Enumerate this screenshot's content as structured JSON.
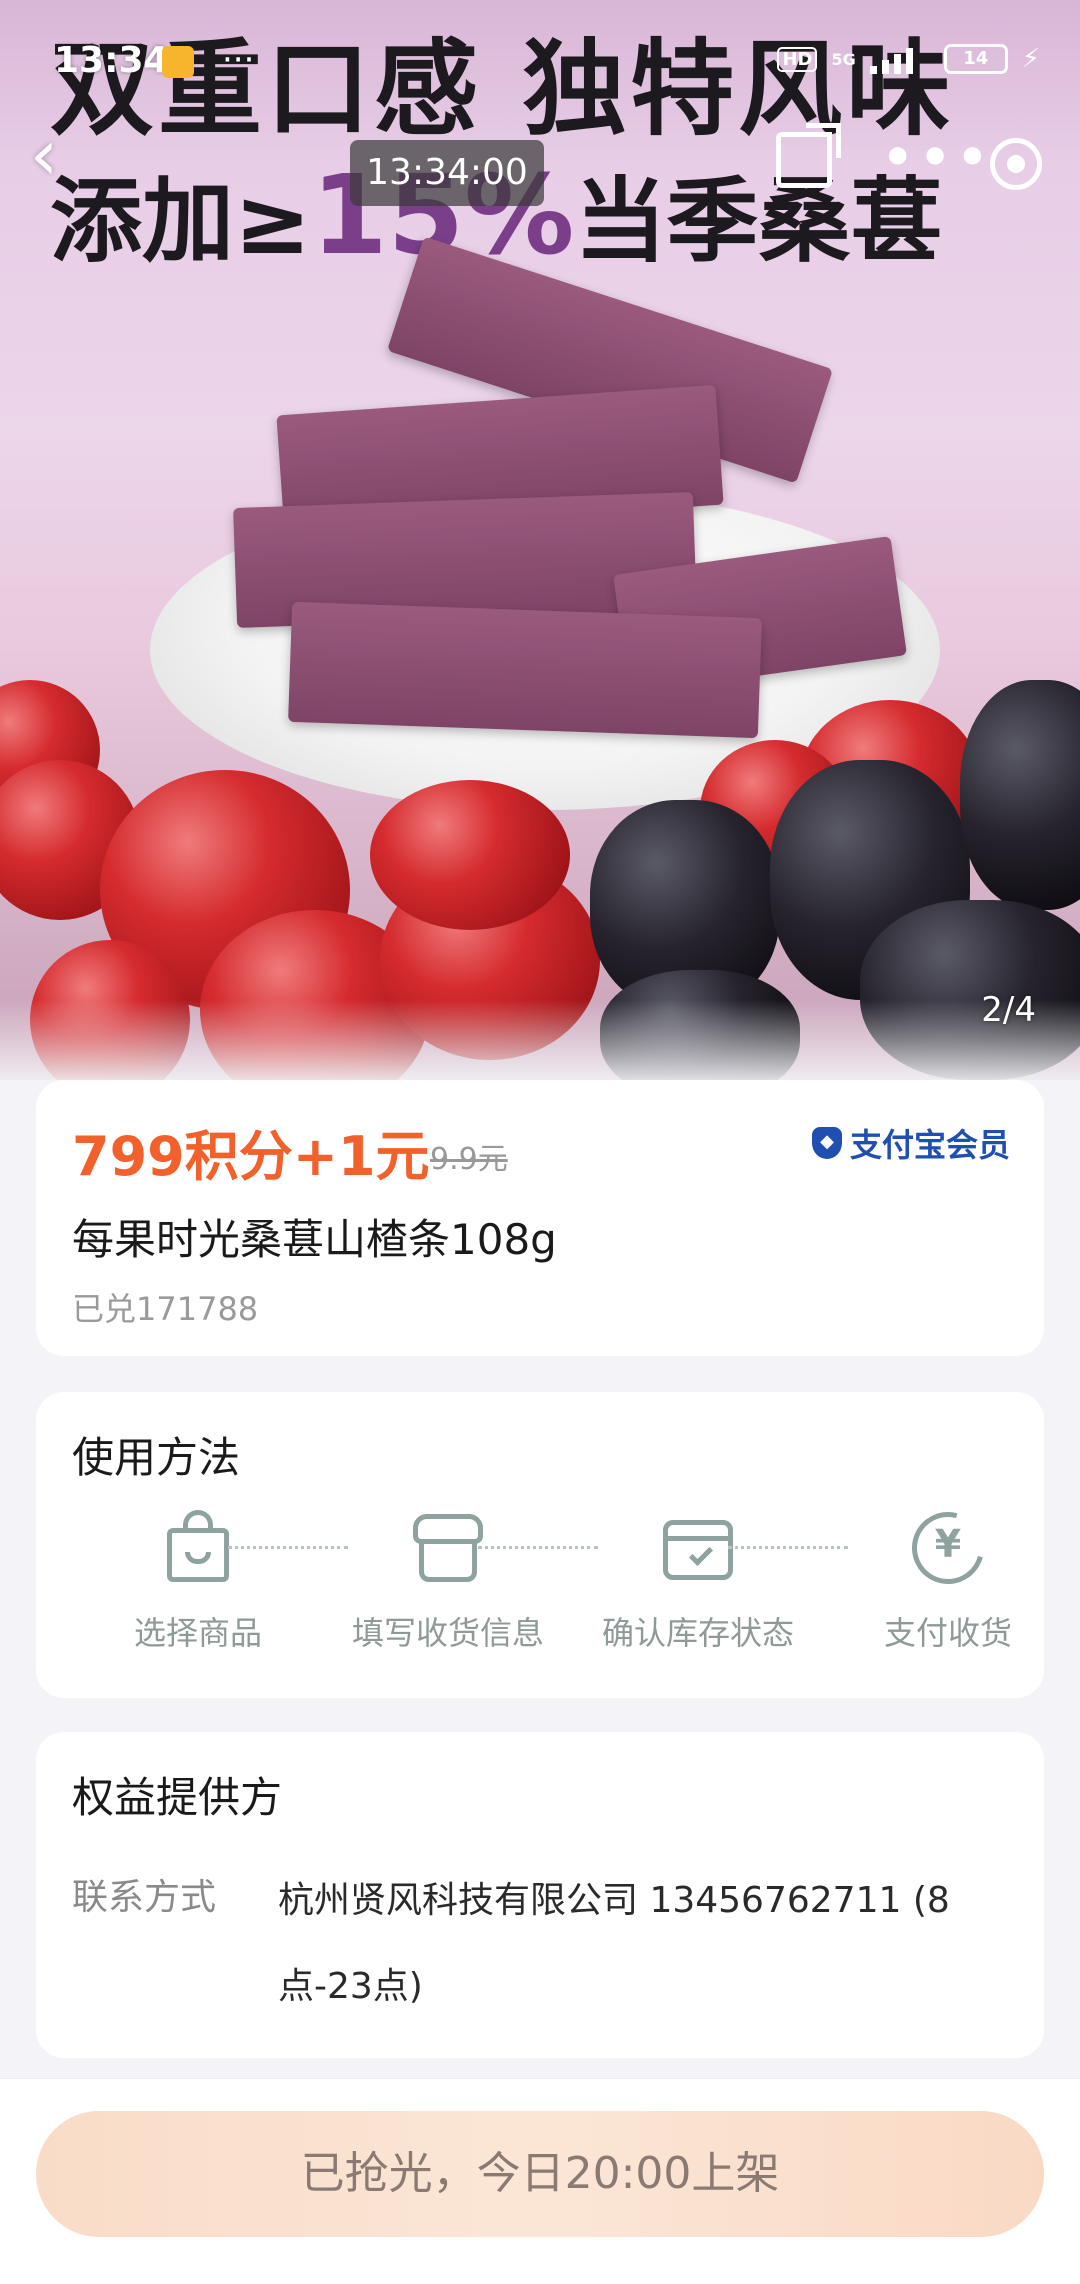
{
  "status_bar": {
    "time": "13:34",
    "dots": "···",
    "hd": "HD",
    "network": "5G",
    "battery": "14"
  },
  "nav": {
    "back_icon": "back-chevron-icon",
    "clock": "13:34:00",
    "share_icon": "share-icon",
    "more_icon": "more-icon",
    "target_icon": "target-icon"
  },
  "hero": {
    "headline_line1": "双重口感 独特风味",
    "headline_line2_a": "添加≥",
    "headline_line2_pct": "15%",
    "headline_line2_b": "当季桑葚",
    "page_indicator": "2/4"
  },
  "product": {
    "price": "799积分+1元",
    "original_price": "9.9元",
    "member_badge": "支付宝会员",
    "name": "每果时光桑葚山楂条108g",
    "sold": "已兑171788"
  },
  "usage": {
    "title": "使用方法",
    "steps": [
      {
        "label": "选择商品",
        "icon": "shopping-bag-icon"
      },
      {
        "label": "填写收货信息",
        "icon": "store-icon"
      },
      {
        "label": "确认库存状态",
        "icon": "package-check-icon"
      },
      {
        "label": "支付收货",
        "icon": "yuan-refresh-icon"
      }
    ]
  },
  "provider": {
    "title": "权益提供方",
    "contact_label": "联系方式",
    "contact_value": "杭州贤风科技有限公司 13456762711 (8点-23点)"
  },
  "bottom": {
    "button_label": "已抢光，今日20:00上架"
  },
  "colors": {
    "price": "#f2602c",
    "alipay_blue": "#1f4fb0",
    "step_icon": "#8ea3a0"
  }
}
